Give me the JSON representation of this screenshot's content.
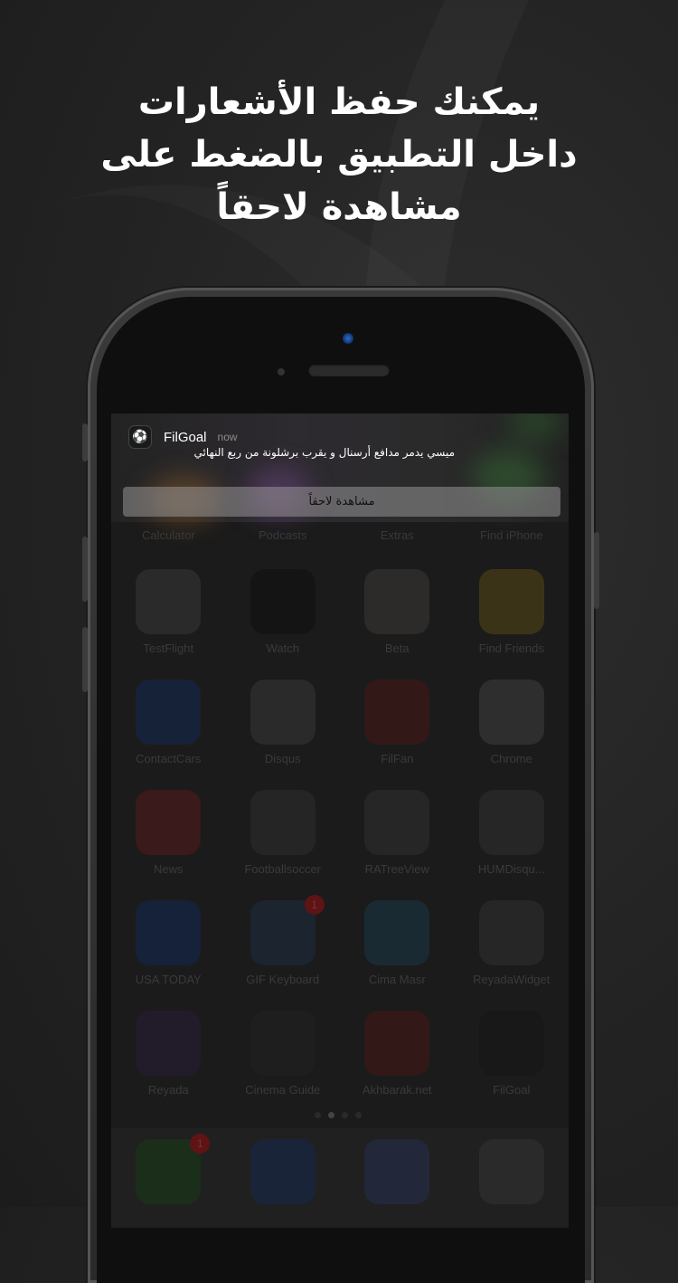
{
  "headline": {
    "line1": "يمكنك حفظ الأشعارات",
    "line2": "داخل التطبيق بالضغط على",
    "line3": "مشاهدة لاحقاً"
  },
  "notification": {
    "app_name": "FilGoal",
    "time": "now",
    "body": "ميسي يدمر مدافع أرسنال و يقرب برشلونة من ربع النهائي",
    "action_label": "مشاهدة لاحقاً"
  },
  "home_screen": {
    "top_row_labels": [
      "Calculator",
      "Podcasts",
      "Extras",
      "Find iPhone"
    ],
    "rows": [
      [
        {
          "label": "TestFlight",
          "color": "#2a2a2a",
          "icon": "apple-icon"
        },
        {
          "label": "Watch",
          "color": "#141414",
          "icon": "watch-icon"
        },
        {
          "label": "Beta",
          "color": "#2d2a2a",
          "icon": "beta-icon"
        },
        {
          "label": "Find Friends",
          "color": "#3a3318",
          "icon": "friends-icon"
        }
      ],
      [
        {
          "label": "ContactCars",
          "color": "#162238",
          "icon": "contactcars-icon"
        },
        {
          "label": "Disqus",
          "color": "#2a2a2a",
          "icon": "disqus-icon"
        },
        {
          "label": "FilFan",
          "color": "#331818",
          "icon": "filfan-icon"
        },
        {
          "label": "Chrome",
          "color": "#2e2e2e",
          "icon": "chrome-icon"
        }
      ],
      [
        {
          "label": "News",
          "color": "#3a1a1a",
          "icon": "news-icon"
        },
        {
          "label": "Footballsoccer",
          "color": "#252525",
          "icon": "folder-icon"
        },
        {
          "label": "RATreeView",
          "color": "#262626",
          "icon": "blank-app-icon"
        },
        {
          "label": "HUMDisqu...",
          "color": "#262626",
          "icon": "blank-app-icon"
        }
      ],
      [
        {
          "label": "USA TODAY",
          "color": "#16213a",
          "icon": "usatoday-icon"
        },
        {
          "label": "GIF Keyboard",
          "color": "#1c2430",
          "icon": "gif-icon",
          "badge": "1"
        },
        {
          "label": "Cima Masr",
          "color": "#1a2a33",
          "icon": "film-icon"
        },
        {
          "label": "ReyadaWidget",
          "color": "#262626",
          "icon": "blank-app-icon"
        }
      ],
      [
        {
          "label": "Reyada",
          "color": "#221c2a",
          "icon": "reyada-icon"
        },
        {
          "label": "Cinema Guide",
          "color": "#1e1e1e",
          "icon": "cinema-icon"
        },
        {
          "label": "Akhbarak.net",
          "color": "#331818",
          "icon": "akhbarak-icon"
        },
        {
          "label": "FilGoal",
          "color": "#181818",
          "icon": "filgoal-icon"
        }
      ]
    ],
    "dock": [
      {
        "color": "#1a2e1a",
        "icon": "phone-icon",
        "badge": "1"
      },
      {
        "color": "#1a2438",
        "icon": "mail-icon"
      },
      {
        "color": "#22283a",
        "icon": "safari-icon"
      },
      {
        "color": "#2a2a2a",
        "icon": "music-icon"
      }
    ]
  }
}
